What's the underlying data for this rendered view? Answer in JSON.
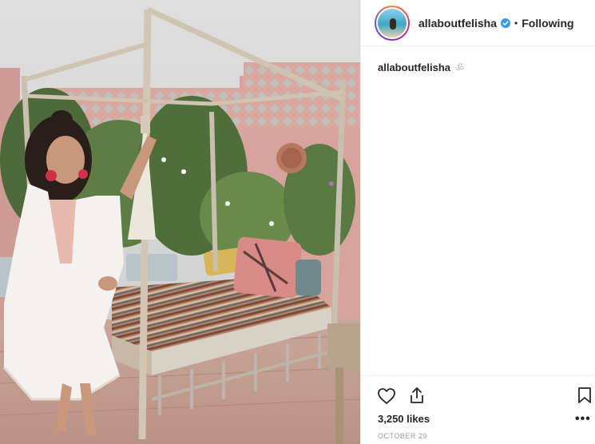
{
  "post": {
    "username": "allaboutfelisha",
    "follow_status": "Following",
    "separator": "•",
    "caption_user": "allaboutfelisha",
    "caption_emoji": "ॐ",
    "likes": "3,250 likes",
    "date": "OCTOBER 29"
  },
  "icons": {
    "verified": "verified-badge-icon",
    "like": "heart-icon",
    "share": "share-icon",
    "save": "bookmark-icon",
    "more": "more-options-icon"
  },
  "colors": {
    "verified_blue": "#3897f0",
    "text": "#262626",
    "muted": "#999999",
    "border": "#efefef"
  }
}
